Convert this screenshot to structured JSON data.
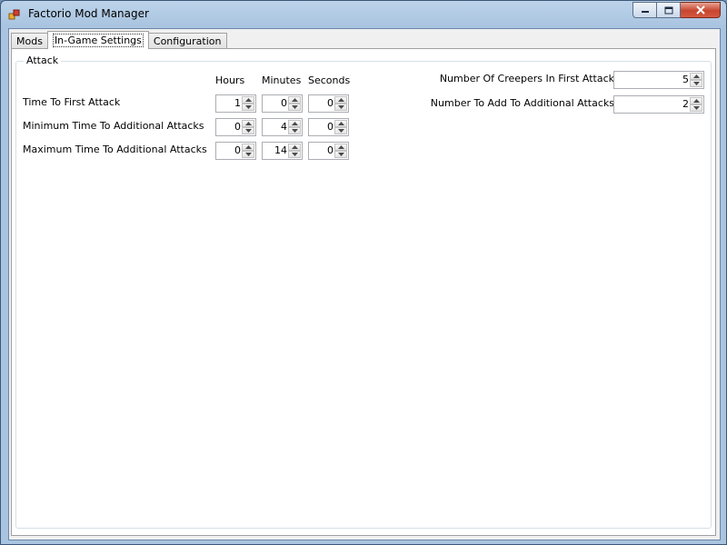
{
  "window": {
    "title": "Factorio Mod Manager",
    "icons": {
      "app": "app-icon",
      "minimize": "minimize-icon",
      "maximize": "maximize-icon",
      "close": "close-icon"
    }
  },
  "tabs": [
    {
      "label": "Mods",
      "active": false
    },
    {
      "label": "In-Game Settings",
      "active": true
    },
    {
      "label": "Configuration",
      "active": false
    }
  ],
  "attack": {
    "group_title": "Attack",
    "columns": {
      "hours": "Hours",
      "minutes": "Minutes",
      "seconds": "Seconds"
    },
    "rows": [
      {
        "label": "Time To First Attack",
        "hours": "1",
        "minutes": "0",
        "seconds": "0"
      },
      {
        "label": "Minimum Time To Additional Attacks",
        "hours": "0",
        "minutes": "4",
        "seconds": "0"
      },
      {
        "label": "Maximum Time To Additional Attacks",
        "hours": "0",
        "minutes": "14",
        "seconds": "0"
      }
    ],
    "creepers_first": {
      "label": "Number Of Creepers In First Attack",
      "value": "5"
    },
    "creepers_additional": {
      "label": "Number To Add To Additional Attacks",
      "value": "2"
    }
  },
  "colors": {
    "titlebar": "#a9c4e0",
    "close_button": "#c7452e",
    "client_bg": "#f0f0f0"
  }
}
